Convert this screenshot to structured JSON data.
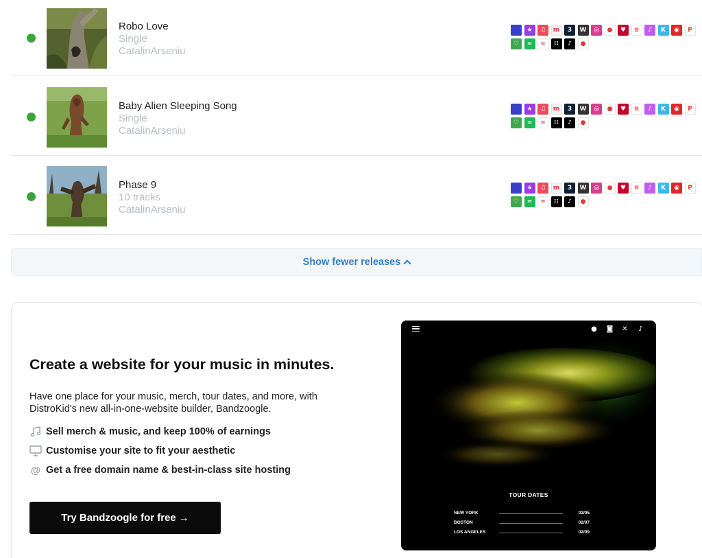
{
  "releases": [
    {
      "title": "Robo Love",
      "type": "Single",
      "artist": "CatalinArseniu",
      "status": "live"
    },
    {
      "title": "Baby Alien Sleeping Song",
      "type": "Single",
      "artist": "CatalinArseniu",
      "status": "live"
    },
    {
      "title": "Phase 9",
      "type": "10 tracks",
      "artist": "CatalinArseniu",
      "status": "live"
    }
  ],
  "stores_row1": [
    {
      "icon": "amazon-music-icon",
      "color": "#3b3fc9",
      "glyph": ""
    },
    {
      "icon": "anghami-icon",
      "color": "#9a3be6",
      "glyph": "★"
    },
    {
      "icon": "apple-music-icon",
      "color": "#f04a5c",
      "glyph": "♫"
    },
    {
      "icon": "boomplay-icon",
      "color": "#f2f2f2",
      "glyph": "m"
    },
    {
      "icon": "audiomack-icon",
      "color": "#0f1f33",
      "glyph": "3"
    },
    {
      "icon": "claro-musica-icon",
      "color": "#333333",
      "glyph": "W"
    },
    {
      "icon": "instagram-icon",
      "color": "#d83f8e",
      "glyph": "◎"
    },
    {
      "icon": "youtube-music-icon",
      "color": "#ffffff",
      "glyph": "●"
    },
    {
      "icon": "iheartradio-icon",
      "color": "#c6002b",
      "glyph": "♥"
    },
    {
      "icon": "jiosaavn-icon",
      "color": "#ffffff",
      "glyph": "≡"
    },
    {
      "icon": "itunes-icon",
      "color": "#c05cf2",
      "glyph": "♪"
    },
    {
      "icon": "kkbox-icon",
      "color": "#3fb6e8",
      "glyph": "K"
    },
    {
      "icon": "netease-icon",
      "color": "#e02828",
      "glyph": "◉"
    },
    {
      "icon": "pandora-icon",
      "color": "#ffffff",
      "glyph": "P"
    }
  ],
  "stores_row2": [
    {
      "icon": "saavn-icon",
      "color": "#3fa84f",
      "glyph": "♡"
    },
    {
      "icon": "spotify-icon",
      "color": "#1db954",
      "glyph": "≈"
    },
    {
      "icon": "tencent-icon",
      "color": "#ffffff",
      "glyph": "≈"
    },
    {
      "icon": "tidal-icon",
      "color": "#000000",
      "glyph": "∷"
    },
    {
      "icon": "tiktok-icon",
      "color": "#000000",
      "glyph": "♪"
    },
    {
      "icon": "yandex-music-icon",
      "color": "#ffffff",
      "glyph": "●"
    }
  ],
  "toggle": {
    "label": "Show fewer releases"
  },
  "promo": {
    "heading": "Create a website for your music in minutes.",
    "description": "Have one place for your music, merch, tour dates, and more, with DistroKid's new all-in-one-website builder, Bandzoogle.",
    "features": [
      {
        "icon": "music-note-icon",
        "text": "Sell merch & music, and keep 100% of earnings"
      },
      {
        "icon": "monitor-icon",
        "text": "Customise your site to fit your aesthetic"
      },
      {
        "icon": "at-sign-icon",
        "text": "Get a free domain name & best-in-class site hosting"
      }
    ],
    "cta": "Try Bandzoogle for free",
    "preview": {
      "tour_title": "TOUR DATES",
      "dates": [
        {
          "city": "NEW YORK",
          "date": "02/05"
        },
        {
          "city": "BOSTON",
          "date": "02/07"
        },
        {
          "city": "LOS ANGELES",
          "date": "02/09"
        }
      ]
    }
  }
}
